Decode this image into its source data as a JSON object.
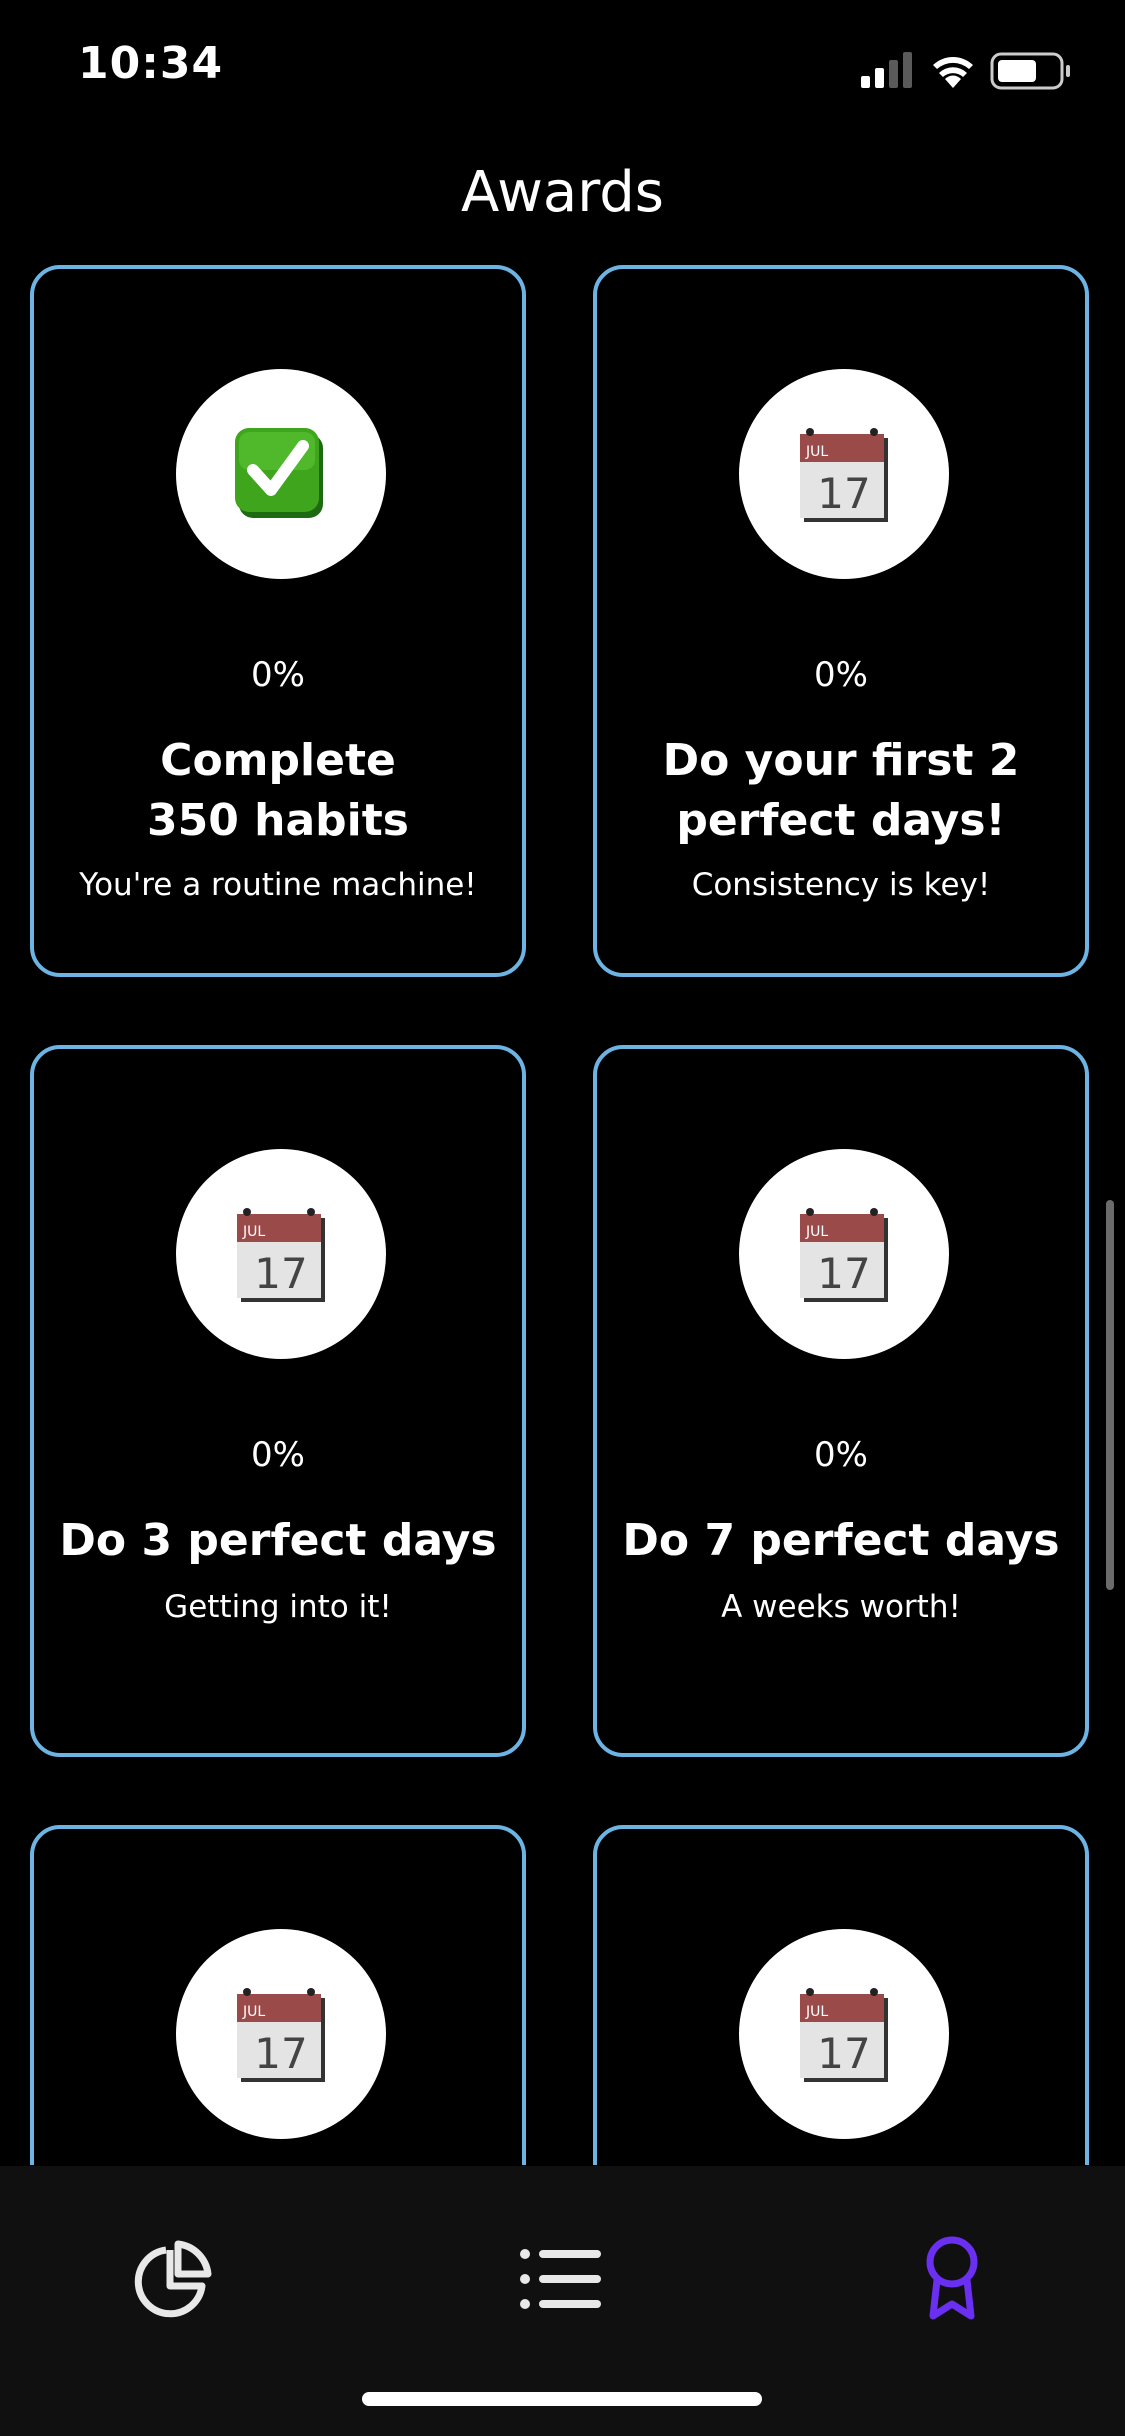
{
  "status_bar": {
    "time": "10:34"
  },
  "header": {
    "title": "Awards"
  },
  "awards": [
    {
      "icon": "check-mark-icon",
      "percent": "0%",
      "title": "Complete 350 habits",
      "subtitle": "You're a routine machine!"
    },
    {
      "icon": "calendar-icon",
      "percent": "0%",
      "title": "Do your first 2 perfect days!",
      "subtitle": "Consistency is key!"
    },
    {
      "icon": "calendar-icon",
      "percent": "0%",
      "title": "Do 3 perfect days",
      "subtitle": "Getting into it!"
    },
    {
      "icon": "calendar-icon",
      "percent": "0%",
      "title": "Do 7 perfect days",
      "subtitle": "A weeks worth!"
    },
    {
      "icon": "calendar-icon"
    },
    {
      "icon": "calendar-icon"
    }
  ],
  "calendar_icon": {
    "month": "JUL",
    "day": "17"
  },
  "tab_bar": {
    "tabs": [
      "stats",
      "habits-list",
      "awards"
    ],
    "active": "awards",
    "active_color": "#6a2ff0",
    "inactive_color": "#e8e8e8"
  },
  "colors": {
    "card_border": "#6cb4e4",
    "background": "#000000"
  }
}
